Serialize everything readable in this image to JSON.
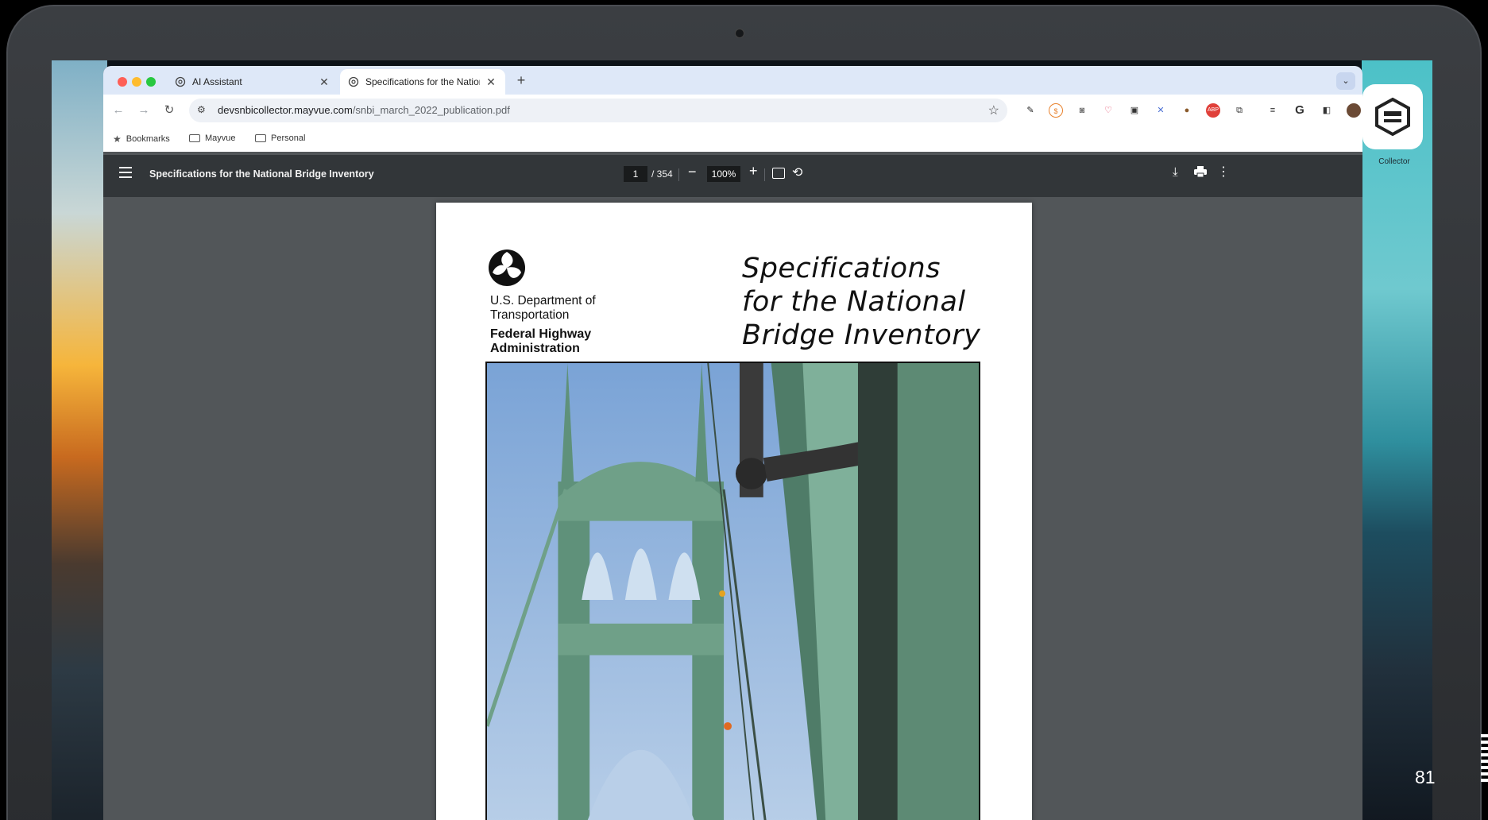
{
  "browser": {
    "tabs": [
      {
        "label": "AI Assistant",
        "active": false
      },
      {
        "label": "Specifications for the National Bridge Inventory",
        "active": true
      }
    ],
    "new_tab_label": "+",
    "url_host": "devsnbicollector.mayvue.com",
    "url_path": "/snbi_march_2022_publication.pdf",
    "bookmarks": [
      {
        "label": "Bookmarks",
        "icon": "star-icon"
      },
      {
        "label": "Mayvue",
        "icon": "folder-icon"
      },
      {
        "label": "Personal",
        "icon": "folder-icon"
      }
    ]
  },
  "pdf_viewer": {
    "title": "Specifications for the National Bridge Inventory",
    "current_page": "1",
    "total_pages": "/ 354",
    "zoom": "100%"
  },
  "document": {
    "department": "U.S. Department of Transportation",
    "agency": "Federal Highway Administration",
    "title_lines": [
      "Specifications",
      "for the National",
      "Bridge Inventory"
    ]
  },
  "desktop": {
    "app_label": "Collector"
  },
  "slide": {
    "number": "81"
  },
  "colors": {
    "tabstrip": "#dee8f8",
    "pdf_toolbar": "#323639",
    "pdf_background": "#525659",
    "bridge_green": "#6fa088"
  }
}
